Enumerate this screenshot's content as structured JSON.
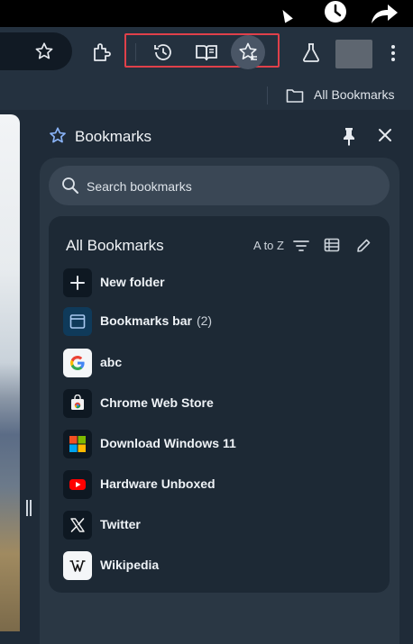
{
  "toolbar": {
    "bookmarks_bar_item": "All Bookmarks"
  },
  "panel": {
    "title": "Bookmarks",
    "search_placeholder": "Search bookmarks",
    "section_title": "All Bookmarks",
    "sort_label": "A to Z"
  },
  "items": [
    {
      "label": "New folder",
      "count": "",
      "icon": "plus-icon"
    },
    {
      "label": "Bookmarks bar",
      "count": "(2)",
      "icon": "bookmarks-bar-folder-icon"
    },
    {
      "label": "abc",
      "count": "",
      "icon": "google-icon"
    },
    {
      "label": "Chrome Web Store",
      "count": "",
      "icon": "chrome-web-store-icon"
    },
    {
      "label": "Download Windows 11",
      "count": "",
      "icon": "windows-logo-icon"
    },
    {
      "label": "Hardware Unboxed",
      "count": "",
      "icon": "youtube-icon"
    },
    {
      "label": "Twitter",
      "count": "",
      "icon": "x-logo-icon"
    },
    {
      "label": "Wikipedia",
      "count": "",
      "icon": "wikipedia-icon"
    }
  ],
  "colors": {
    "highlight_border": "#e0404a",
    "panel_bg": "#2a3744",
    "card_bg": "#1d2935",
    "accent_star": "#8ab4f8"
  }
}
